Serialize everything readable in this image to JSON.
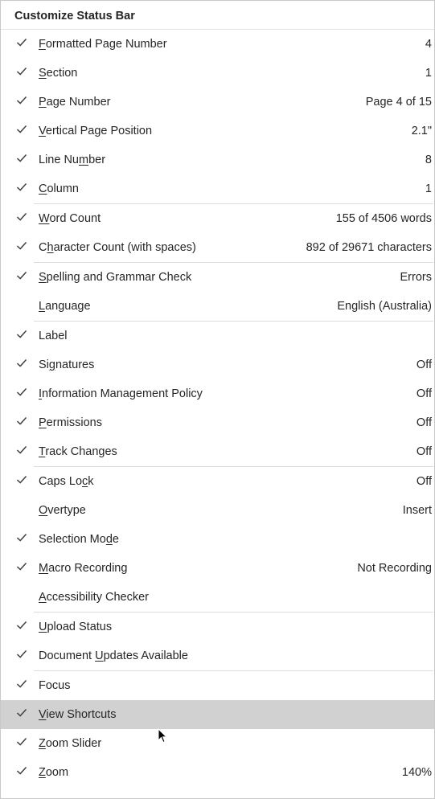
{
  "menu": {
    "title": "Customize Status Bar",
    "groups": [
      [
        {
          "key": "formatted-page-number",
          "label": "Formatted Page Number",
          "accel": 0,
          "value": "4",
          "checked": true
        },
        {
          "key": "section",
          "label": "Section",
          "accel": 0,
          "value": "1",
          "checked": true
        },
        {
          "key": "page-number",
          "label": "Page Number",
          "accel": 0,
          "value": "Page 4 of 15",
          "checked": true
        },
        {
          "key": "vertical-page-position",
          "label": "Vertical Page Position",
          "accel": 0,
          "value": "2.1\"",
          "checked": true
        },
        {
          "key": "line-number",
          "label": "Line Number",
          "accel": 7,
          "value": "8",
          "checked": true
        },
        {
          "key": "column",
          "label": "Column",
          "accel": 0,
          "value": "1",
          "checked": true
        }
      ],
      [
        {
          "key": "word-count",
          "label": "Word Count",
          "accel": 0,
          "value": "155 of 4506 words",
          "checked": true
        },
        {
          "key": "character-count",
          "label": "Character Count (with spaces)",
          "accel": 1,
          "value": "892 of 29671 characters",
          "checked": true
        }
      ],
      [
        {
          "key": "spelling-grammar-check",
          "label": "Spelling and Grammar Check",
          "accel": 0,
          "value": "Errors",
          "checked": true
        },
        {
          "key": "language",
          "label": "Language",
          "accel": 0,
          "value": "English (Australia)",
          "checked": false
        }
      ],
      [
        {
          "key": "label",
          "label": "Label",
          "accel": -1,
          "value": "",
          "checked": true
        },
        {
          "key": "signatures",
          "label": "Signatures",
          "accel": 2,
          "value": "Off",
          "checked": true
        },
        {
          "key": "information-management-policy",
          "label": "Information Management Policy",
          "accel": 0,
          "value": "Off",
          "checked": true
        },
        {
          "key": "permissions",
          "label": "Permissions",
          "accel": 0,
          "value": "Off",
          "checked": true
        },
        {
          "key": "track-changes",
          "label": "Track Changes",
          "accel": 0,
          "value": "Off",
          "checked": true
        }
      ],
      [
        {
          "key": "caps-lock",
          "label": "Caps Lock",
          "accel": 7,
          "value": "Off",
          "checked": true
        },
        {
          "key": "overtype",
          "label": "Overtype",
          "accel": 0,
          "value": "Insert",
          "checked": false
        },
        {
          "key": "selection-mode",
          "label": "Selection Mode",
          "accel": 12,
          "value": "",
          "checked": true
        },
        {
          "key": "macro-recording",
          "label": "Macro Recording",
          "accel": 0,
          "value": "Not Recording",
          "checked": true
        },
        {
          "key": "accessibility-checker",
          "label": "Accessibility Checker",
          "accel": 0,
          "value": "",
          "checked": false
        }
      ],
      [
        {
          "key": "upload-status",
          "label": "Upload Status",
          "accel": 0,
          "value": "",
          "checked": true
        },
        {
          "key": "document-updates-available",
          "label": "Document Updates Available",
          "accel": 9,
          "value": "",
          "checked": true
        }
      ],
      [
        {
          "key": "focus",
          "label": "Focus",
          "accel": -1,
          "value": "",
          "checked": true
        },
        {
          "key": "view-shortcuts",
          "label": "View Shortcuts",
          "accel": 0,
          "value": "",
          "checked": true,
          "hovered": true
        },
        {
          "key": "zoom-slider",
          "label": "Zoom Slider",
          "accel": 0,
          "value": "",
          "checked": true
        },
        {
          "key": "zoom",
          "label": "Zoom",
          "accel": 0,
          "value": "140%",
          "checked": true
        }
      ]
    ]
  },
  "icons": {
    "check": "checkmark-icon",
    "cursor": "mouse-pointer-icon"
  },
  "colors": {
    "hover": "#d1d1d1",
    "check": "#404040",
    "separator": "#dcdcdc",
    "text": "#262626"
  }
}
